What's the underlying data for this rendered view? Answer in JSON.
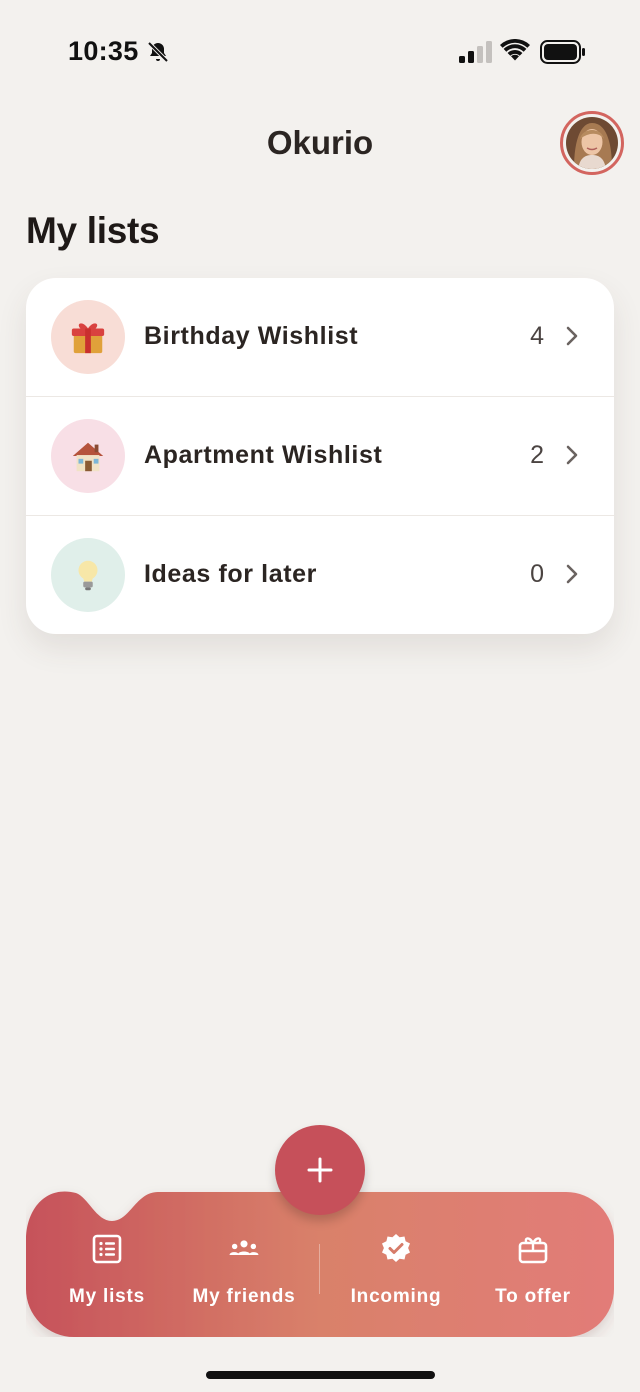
{
  "status_bar": {
    "time": "10:35",
    "icons": [
      "bell-slash-icon",
      "cellular-signal-icon",
      "wifi-icon",
      "battery-icon"
    ]
  },
  "header": {
    "title": "Okurio",
    "avatar": "profile-avatar"
  },
  "section_title": "My lists",
  "lists": [
    {
      "label": "Birthday Wishlist",
      "count": "4",
      "icon": "gift-icon",
      "icon_bg": "#f8ddd6"
    },
    {
      "label": "Apartment Wishlist",
      "count": "2",
      "icon": "house-icon",
      "icon_bg": "#f8dfe6"
    },
    {
      "label": "Ideas for later",
      "count": "0",
      "icon": "lightbulb-icon",
      "icon_bg": "#e0efea"
    }
  ],
  "tab_bar": {
    "fab_icon": "plus-icon",
    "tabs": [
      {
        "label": "My lists",
        "icon": "list-icon"
      },
      {
        "label": "My friends",
        "icon": "friends-icon"
      },
      {
        "label": "Incoming",
        "icon": "verified-badge-icon"
      },
      {
        "label": "To offer",
        "icon": "gift-box-icon"
      }
    ]
  },
  "colors": {
    "background": "#f3f1ee",
    "accent": "#c6505a",
    "tab_gradient_start": "#c6525a",
    "tab_gradient_mid": "#d9816a",
    "tab_gradient_end": "#e27c78",
    "avatar_ring": "#d3655f"
  }
}
